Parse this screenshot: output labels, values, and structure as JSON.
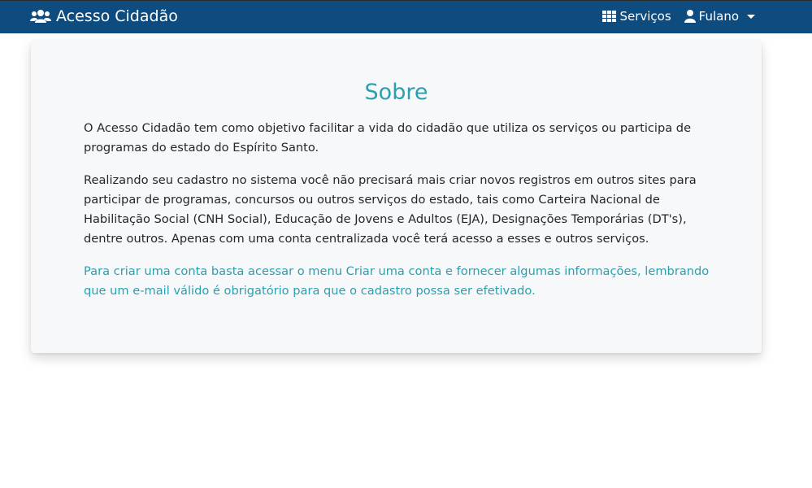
{
  "navbar": {
    "brand_label": "Acesso Cidadão",
    "brand_icon": "users-icon",
    "services_label": "Serviços",
    "services_icon": "grid-icon",
    "user_label": "Fulano",
    "user_icon": "user-icon"
  },
  "colors": {
    "navbar_bg": "#0e4c80",
    "accent": "#2a9fb0",
    "card_bg": "#f7f8fa"
  },
  "about": {
    "title": "Sobre",
    "paragraph_1": "O Acesso Cidadão tem como objetivo facilitar a vida do cidadão que utiliza os serviços ou participa de programas do estado do Espírito Santo.",
    "paragraph_2": "Realizando seu cadastro no sistema você não precisará mais criar novos registros em outros sites para participar de programas, concursos ou outros serviços do estado, tais como Carteira Nacional de Habilitação Social (CNH Social), Educação de Jovens e Adultos (EJA), Designações Temporárias (DT's), dentre outros. Apenas com uma conta centralizada você terá acesso a esses e outros serviços.",
    "paragraph_3": "Para criar uma conta basta acessar o menu Criar uma conta e fornecer algumas informações, lembrando que um e-mail válido é obrigatório para que o cadastro possa ser efetivado."
  }
}
